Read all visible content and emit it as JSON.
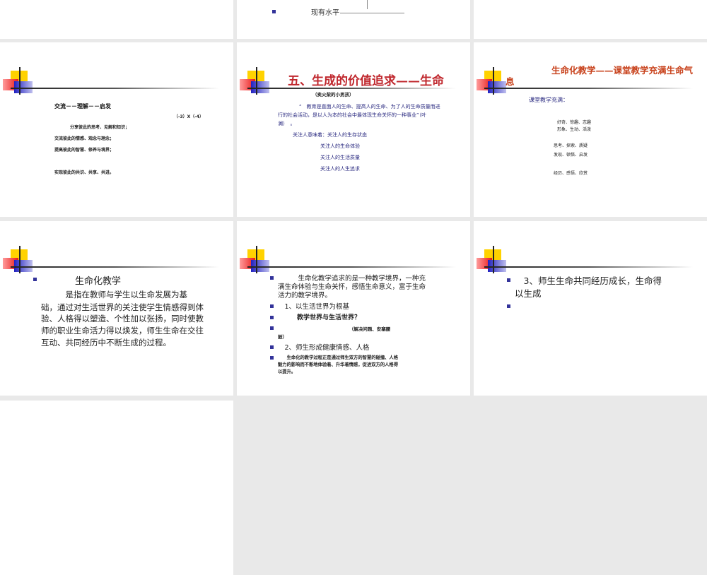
{
  "slides": [
    {
      "id": "row1-col2",
      "bullet_text": "现有水平"
    },
    {
      "id": "slide-exchange",
      "title": "交流－－理解－－启发",
      "formula": "（-3）X（-4）",
      "lines": [
        "分享彼此的思考、见解和知识；",
        "交流彼此的情感、观念与理念；",
        "提高彼此的智慧、修养与境界；",
        "实现彼此的共识、共享、共进。"
      ]
    },
    {
      "id": "slide-value",
      "title": "五、生成的价值追求——生命",
      "subtitle": "（卖火柴的小男孩）",
      "quote": [
        "“　教育是直面人的生命、提高人的生命、为了人的生命质量而进",
        "行的社会活动，是以人为本的社会中最体现生命关怀的一种事业”（叶",
        "澜）　。"
      ],
      "focus": [
        "关注人意味着：关注人的生存状态",
        "关注人的生命体验",
        "关注人的生活质量",
        "关注人的人生追求"
      ],
      "title_color": "#c0282e"
    },
    {
      "id": "slide-classroom",
      "title_line1": "生命化教学——课堂教学充满生命气",
      "title_line2": "息",
      "lead": "课堂教学充满：",
      "items": [
        "好奇、惊趣、志趣",
        "形象、生动、活泼",
        "思考、探索、质疑",
        "发现、顿悟、启发",
        "经历、感悟、欣赏"
      ],
      "title_color": "#c8421c"
    },
    {
      "id": "slide-definition",
      "heading": "生命化教学",
      "paragraph": [
        "　　　是指在教师与学生以生命发展为基",
        "础，通过对生活世界的关注使学生情感得到体",
        "验、人格得以塑造、个性加以张扬，同时使教",
        "师的职业生命活力得以焕发，师生生命在交往",
        "互动、共同经历中不断生成的过程。"
      ]
    },
    {
      "id": "slide-realm",
      "bullets": [
        [
          "　　　生命化教学追求的是一种教学境界，一种充",
          "满生命体验与生命关怀，感悟生命意义，富于生命",
          "活力的教学境界。"
        ],
        [
          "　1、以生活世界为根基"
        ],
        [
          "　　　教学世界与生活世界？"
        ],
        [
          "　　　　　　　　　　　　　　　　（解决问题、安塞腰",
          "鼓）"
        ],
        [
          "　2、师生形成健康情感、人格"
        ],
        [
          "　　生命化的教学过程正是通过师生双方的智慧的碰撞、人格",
          "魅力的影响而不断地体验着、升华着情感，促进双方的人格得",
          "以提升。"
        ]
      ]
    },
    {
      "id": "slide-growth",
      "bullets": [
        [
          "　3、师生生命共同经历成长，生命得",
          "以生成"
        ],
        [
          ""
        ]
      ]
    }
  ]
}
